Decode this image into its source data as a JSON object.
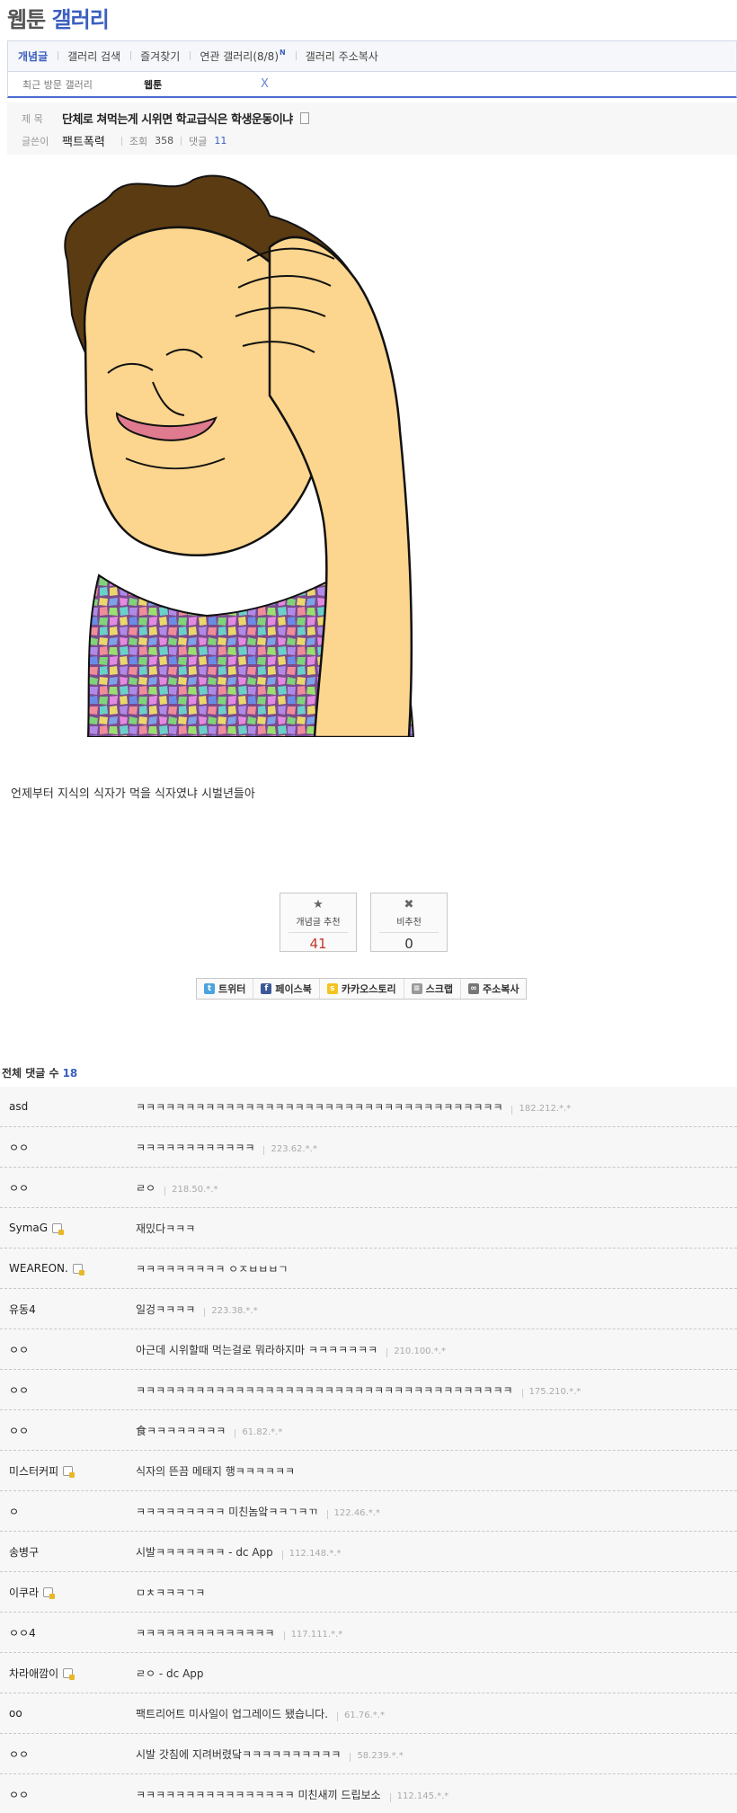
{
  "gallery": {
    "title_part1": "웹툰",
    "title_part2": "갤러리"
  },
  "nav": {
    "items": [
      "개념글",
      "갤러리 검색",
      "즐겨찾기",
      "연관 갤러리(8/8)",
      "갤러리 주소복사"
    ],
    "new_badge": "N"
  },
  "recent": {
    "label": "최근 방문 갤러리",
    "gallery": "웹툰",
    "close": "X"
  },
  "post": {
    "title_label": "제 목",
    "title": "단체로 쳐먹는게 시위면 학교급식은 학생운동이냐",
    "author_label": "글쓴이",
    "author": "팩트폭력",
    "views_label": "조회",
    "views": "358",
    "comments_label": "댓글",
    "comments": "11",
    "body": "언제부터 지식의 식자가 먹을 식자였냐 시벌년들아"
  },
  "votes": {
    "up_label": "개념글 추천",
    "up": "41",
    "down_label": "비추천",
    "down": "0",
    "up_color": "#c0392b"
  },
  "share": {
    "items": [
      "트위터",
      "페이스북",
      "카카오스토리",
      "스크랩",
      "주소복사"
    ]
  },
  "comment_section": {
    "label": "전체 댓글 수",
    "count": "18"
  },
  "comments": [
    {
      "name": "asd",
      "text": "ㅋㅋㅋㅋㅋㅋㅋㅋㅋㅋㅋㅋㅋㅋㅋㅋㅋㅋㅋㅋㅋㅋㅋㅋㅋㅋㅋㅋㅋㅋㅋㅋㅋㅋㅋㅋㅋ",
      "ip": "182.212.*.*",
      "badge": false
    },
    {
      "name": "ㅇㅇ",
      "text": "ㅋㅋㅋㅋㅋㅋㅋㅋㅋㅋㅋㅋ",
      "ip": "223.62.*.*",
      "badge": false
    },
    {
      "name": "ㅇㅇ",
      "text": "ㄹㅇ",
      "ip": "218.50.*.*",
      "badge": false
    },
    {
      "name": "SymaG",
      "text": "재밌다ㅋㅋㅋ",
      "ip": "",
      "badge": true
    },
    {
      "name": "WEAREON.",
      "text": "ㅋㅋㅋㅋㅋㅋㅋㅋㅋ ㅇㅈㅂㅂㅂㄱ",
      "ip": "",
      "badge": true
    },
    {
      "name": "유동4",
      "text": "일겅ㅋㅋㅋㅋ",
      "ip": "223.38.*.*",
      "badge": false
    },
    {
      "name": "ㅇㅇ",
      "text": "아근데 시위할때 먹는걸로 뭐라하지마 ㅋㅋㅋㅋㅋㅋㅋ",
      "ip": "210.100.*.*",
      "badge": false
    },
    {
      "name": "ㅇㅇ",
      "text": "ㅋㅋㅋㅋㅋㅋㅋㅋㅋㅋㅋㅋㅋㅋㅋㅋㅋㅋㅋㅋㅋㅋㅋㅋㅋㅋㅋㅋㅋㅋㅋㅋㅋㅋㅋㅋㅋㅋ",
      "ip": "175.210.*.*",
      "badge": false
    },
    {
      "name": "ㅇㅇ",
      "text": "食ㅋㅋㅋㅋㅋㅋㅋㅋ",
      "ip": "61.82.*.*",
      "badge": false
    },
    {
      "name": "미스터커피",
      "text": "식자의 뜬끔 메태지 행ㅋㅋㅋㅋㅋㅋ",
      "ip": "",
      "badge": true
    },
    {
      "name": "ㅇ",
      "text": "ㅋㅋㅋㅋㅋㅋㅋㅋㅋ 미친놈앜ㅋㅋㄱㅋㄲ",
      "ip": "122.46.*.*",
      "badge": false
    },
    {
      "name": "송병구",
      "text": "시발ㅋㅋㅋㅋㅋㅋㅋ - dc App",
      "ip": "112.148.*.*",
      "badge": false
    },
    {
      "name": "이쿠라",
      "text": "ㅁㅊㅋㅋㅋㄱㅋ",
      "ip": "",
      "badge": true
    },
    {
      "name": "ㅇㅇ4",
      "text": "ㅋㅋㅋㅋㅋㅋㅋㅋㅋㅋㅋㅋㅋㅋ",
      "ip": "117.111.*.*",
      "badge": false
    },
    {
      "name": "차라애깜이",
      "text": "ㄹㅇ - dc App",
      "ip": "",
      "badge": true
    },
    {
      "name": "oo",
      "text": "팩트리어트 미사일이 업그레이드 됐습니다.",
      "ip": "61.76.*.*",
      "badge": false
    },
    {
      "name": "ㅇㅇ",
      "text": "시발 갓침에 지려버렸닼ㅋㅋㅋㅋㅋㅋㅋㅋㅋㅋ",
      "ip": "58.239.*.*",
      "badge": false
    },
    {
      "name": "ㅇㅇ",
      "text": "ㅋㅋㅋㅋㅋㅋㅋㅋㅋㅋㅋㅋㅋㅋㅋㅋ 미친새끼 드립보소",
      "ip": "112.145.*.*",
      "badge": false
    }
  ]
}
